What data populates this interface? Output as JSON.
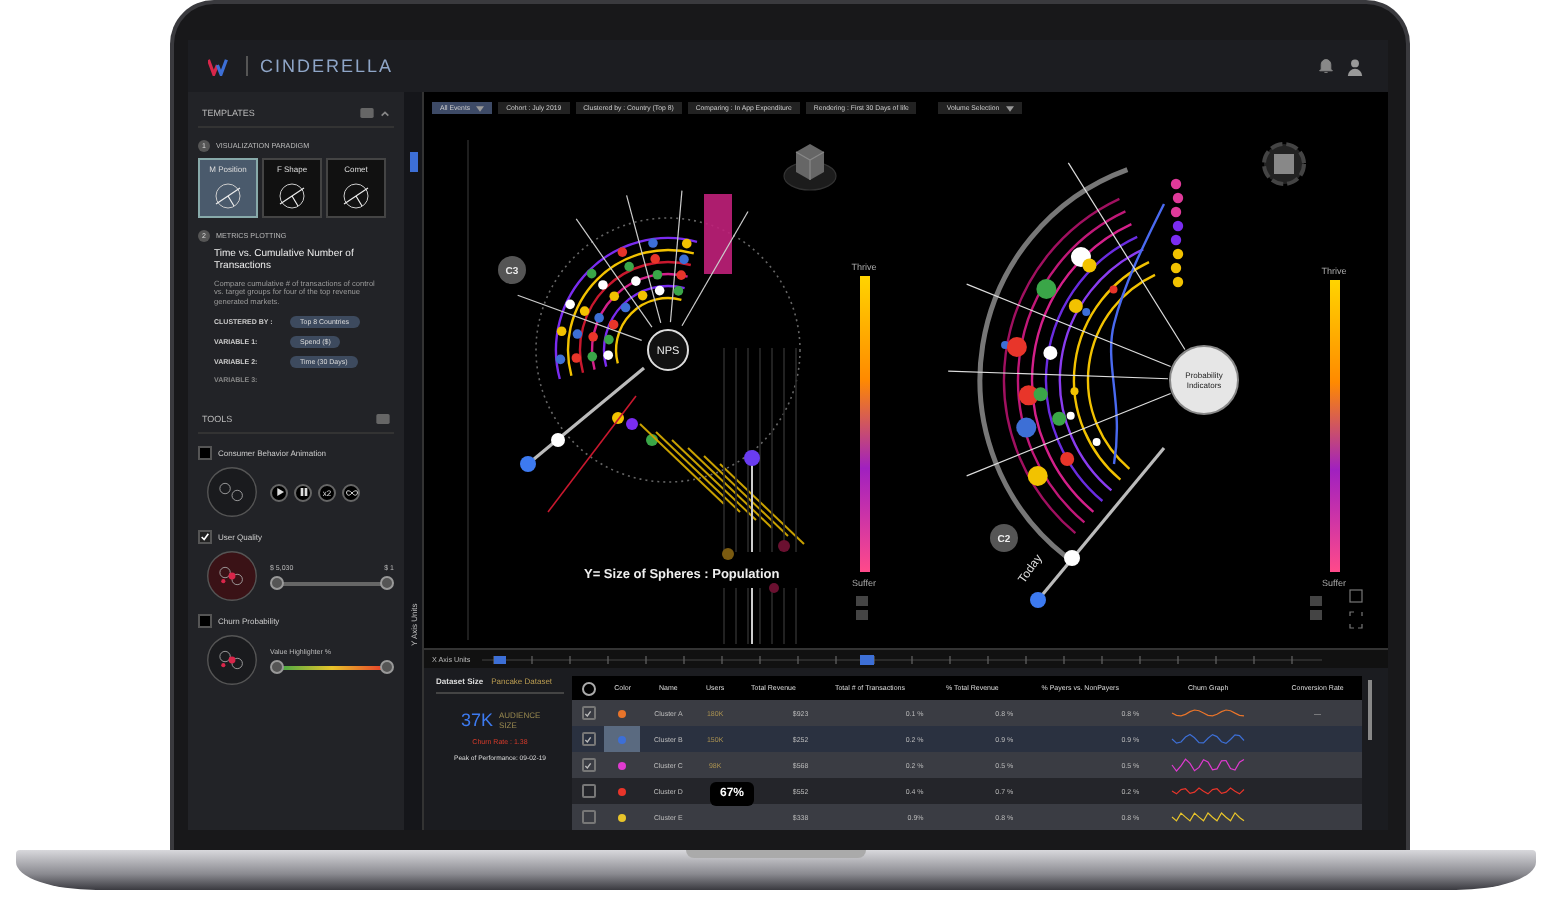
{
  "app": {
    "title": "CINDERELLA"
  },
  "templates": {
    "title": "TEMPLATES",
    "paradigm": {
      "step": "1",
      "title": "VISUALIZATION PARADIGM",
      "thumbs": [
        {
          "label": "M Position",
          "selected": true
        },
        {
          "label": "F Shape",
          "selected": false
        },
        {
          "label": "Comet",
          "selected": false
        }
      ]
    },
    "metrics": {
      "step": "2",
      "title": "METRICS PLOTTING",
      "heading": "Time vs. Cumulative Number of Transactions",
      "description": "Compare cumulative # of transactions of control vs. target groups for four of the top revenue generated markets.",
      "variables": [
        {
          "label": "CLUSTERED BY :",
          "value": "Top 8 Countries"
        },
        {
          "label": "VARIABLE 1:",
          "value": "Spend ($)"
        },
        {
          "label": "VARIABLE 2:",
          "value": "Time (30 Days)"
        },
        {
          "label": "VARIABLE 3:"
        }
      ]
    }
  },
  "tools": {
    "title": "TOOLS",
    "items": [
      {
        "kind": "player",
        "label": "Consumer Behavior Animation",
        "checked": false,
        "speed": "x2"
      },
      {
        "kind": "range",
        "label": "User Quality",
        "checked": true,
        "high": "$ 5,030",
        "low": "$ 1",
        "level": 1
      },
      {
        "kind": "gradient",
        "label": "Churn Probability",
        "checked": false,
        "caption": "Value Highlighter %",
        "level": 1
      }
    ]
  },
  "filters": [
    {
      "kind": "dropdown",
      "label": "All Events"
    },
    {
      "kind": "chip",
      "label": "Cohort : July 2019"
    },
    {
      "kind": "chip",
      "label": "Clustered by : Country (Top 8)"
    },
    {
      "kind": "chip",
      "label": "Comparing : In App Expenditure"
    },
    {
      "kind": "chip",
      "label": "Rendering : First 30 Days of life"
    },
    {
      "kind": "dropdown",
      "label": "Volume Selection"
    }
  ],
  "viz": {
    "left": {
      "badge": "C3",
      "center": "NPS",
      "caption": "Y= Size of Spheres : Population",
      "scale_top": "Thrive",
      "scale_bottom": "Suffer"
    },
    "right": {
      "badge": "C2",
      "center": "Probability Indicators",
      "slider": "Today",
      "scale_top": "Thrive",
      "scale_bottom": "Suffer"
    },
    "y_axis": "Y Axis Units",
    "x_axis": "X Axis Units",
    "timeline": {
      "level": 0.1
    },
    "x_slider": {
      "level": 0.45
    }
  },
  "dataset": {
    "title": "Dataset Size",
    "subtitle": "Pancake Dataset",
    "value": "37K",
    "value_label": "AUDIENCE SIZE",
    "churn": "Churn Rate : 1.38",
    "peak": "Peak of Performance: 09-02-19"
  },
  "table": {
    "all_checked": false,
    "columns": [
      "Color",
      "Name",
      "Users",
      "Total Revenue",
      "Total # of Transactions",
      "% Total Revenue",
      "% Payers vs. NonPayers",
      "Churn Graph",
      "Conversion Rate"
    ],
    "rows": [
      {
        "checked": true,
        "selected": false,
        "color": "#e8742a",
        "name": "Cluster A",
        "users": "180K",
        "revenue": "$923",
        "transactions": "0.1 %",
        "pct_revenue": "0.8 %",
        "payers": "0.8 %",
        "conversion": "—"
      },
      {
        "checked": true,
        "selected": true,
        "color": "#3d6fd6",
        "name": "Cluster B",
        "users": "150K",
        "revenue": "$252",
        "transactions": "0.2 %",
        "pct_revenue": "0.9 %",
        "payers": "0.9 %"
      },
      {
        "checked": true,
        "selected": false,
        "color": "#e03ad0",
        "name": "Cluster C",
        "users": "98K",
        "revenue": "$568",
        "transactions": "0.2 %",
        "pct_revenue": "0.5 %",
        "payers": "0.5 %"
      },
      {
        "checked": false,
        "selected": false,
        "color": "#e8352a",
        "name": "Cluster D",
        "revenue": "$552",
        "transactions": "0.4 %",
        "pct_revenue": "0.7 %",
        "payers": "0.2 %"
      },
      {
        "checked": false,
        "selected": false,
        "color": "#e8c42a",
        "name": "Cluster E",
        "revenue": "$338",
        "transactions": "0.9%",
        "pct_revenue": "0.8 %",
        "payers": "0.8 %"
      }
    ]
  },
  "tooltip": "67%"
}
